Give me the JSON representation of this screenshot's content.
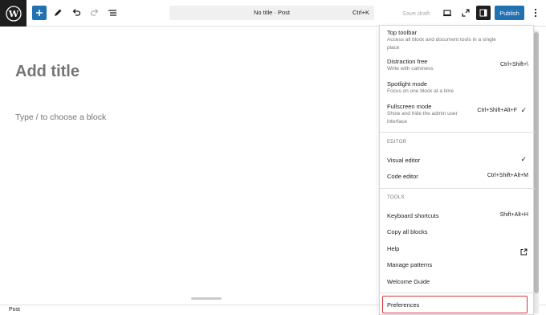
{
  "topbar": {
    "doc_title": "No title · Post",
    "doc_shortcut": "Ctrl+K",
    "save_draft": "Save draft",
    "publish": "Publish",
    "colors": {
      "accent": "#2271b1",
      "dark": "#1e1e1e"
    }
  },
  "canvas": {
    "title_placeholder": "Add title",
    "block_placeholder": "Type / to choose a block"
  },
  "status": {
    "breadcrumb": "Post"
  },
  "menu": {
    "view": [
      {
        "label": "Top toolbar",
        "desc": "Access all block and document tools in a single place",
        "shortcut": "",
        "checked": false
      },
      {
        "label": "Distraction free",
        "desc": "Write with calmness",
        "shortcut": "Ctrl+Shift+\\",
        "checked": false
      },
      {
        "label": "Spotlight mode",
        "desc": "Focus on one block at a time",
        "shortcut": "",
        "checked": false
      },
      {
        "label": "Fullscreen mode",
        "desc": "Show and hide the admin user interface",
        "shortcut": "Ctrl+Shift+Alt+F",
        "checked": true
      }
    ],
    "editor_label": "EDITOR",
    "editor": [
      {
        "label": "Visual editor",
        "shortcut": "",
        "checked": true
      },
      {
        "label": "Code editor",
        "shortcut": "Ctrl+Shift+Alt+M",
        "checked": false
      }
    ],
    "tools_label": "TOOLS",
    "tools": [
      {
        "label": "Keyboard shortcuts",
        "shortcut": "Shift+Alt+H"
      },
      {
        "label": "Copy all blocks",
        "shortcut": ""
      },
      {
        "label": "Help",
        "shortcut": "",
        "icon": "external-link-icon"
      },
      {
        "label": "Manage patterns",
        "shortcut": ""
      },
      {
        "label": "Welcome Guide",
        "shortcut": ""
      }
    ],
    "preferences": "Preferences",
    "highlight_color": "#d63638"
  }
}
